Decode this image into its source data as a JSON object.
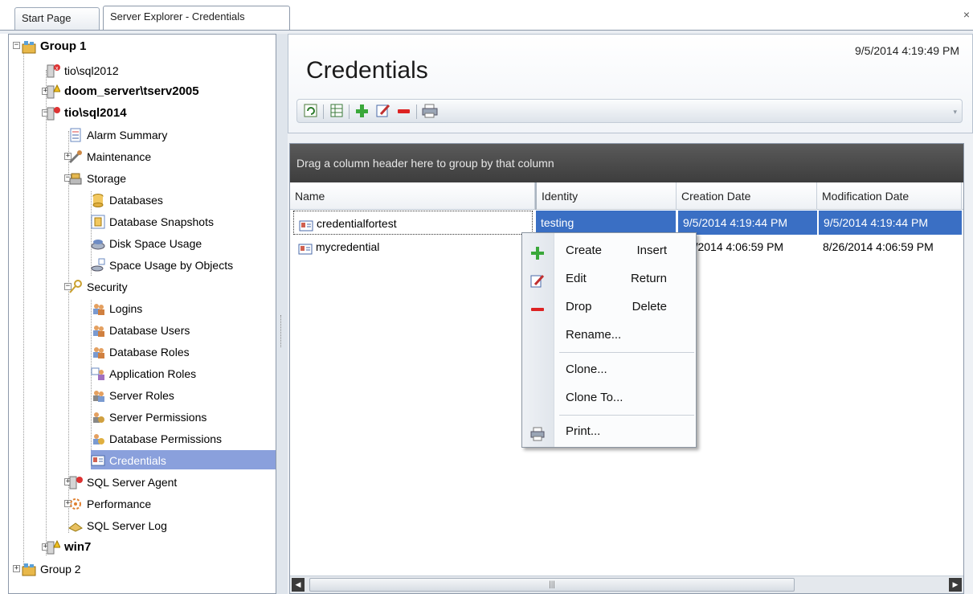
{
  "tabs": {
    "start": "Start Page",
    "server": "Server Explorer - Credentials",
    "close": "×"
  },
  "tree": {
    "group1": "Group 1",
    "tio_sql2012": "tio\\sql2012",
    "doom_server": "doom_server\\tserv2005",
    "tio_sql2014": "tio\\sql2014",
    "alarm_summary": "Alarm Summary",
    "maintenance": "Maintenance",
    "storage": "Storage",
    "databases": "Databases",
    "database_snapshots": "Database Snapshots",
    "disk_space_usage": "Disk Space Usage",
    "space_usage_by_objects": "Space Usage by Objects",
    "security": "Security",
    "logins": "Logins",
    "database_users": "Database Users",
    "database_roles": "Database Roles",
    "application_roles": "Application Roles",
    "server_roles": "Server Roles",
    "server_permissions": "Server Permissions",
    "database_permissions": "Database Permissions",
    "credentials": "Credentials",
    "sql_server_agent": "SQL Server Agent",
    "performance": "Performance",
    "sql_server_log": "SQL Server Log",
    "win7": "win7",
    "group2": "Group 2"
  },
  "header": {
    "title": "Credentials",
    "timestamp": "9/5/2014 4:19:49 PM"
  },
  "grid": {
    "group_hint": "Drag a column header here to group by that column",
    "columns": [
      "Name",
      "Identity",
      "Creation Date",
      "Modification Date"
    ],
    "rows": [
      {
        "name": "credentialfortest",
        "identity": "testing",
        "created": "9/5/2014 4:19:44 PM",
        "modified": "9/5/2014 4:19:44 PM"
      },
      {
        "name": "mycredential",
        "identity": "",
        "created": "8/26/2014 4:06:59 PM",
        "modified": "8/26/2014 4:06:59 PM"
      }
    ],
    "row2_created_visible": "26/2014 4:06:59 PM",
    "scroll_grip": "|||"
  },
  "context_menu": {
    "create": "Create",
    "create_key": "Insert",
    "edit": "Edit",
    "edit_key": "Return",
    "drop": "Drop",
    "drop_key": "Delete",
    "rename": "Rename...",
    "clone": "Clone...",
    "clone_to": "Clone To...",
    "print": "Print..."
  },
  "colors": {
    "selection": "#3a6fc4",
    "tree_selection": "#8aa0dc",
    "group_bar": "#4a4a4a"
  }
}
